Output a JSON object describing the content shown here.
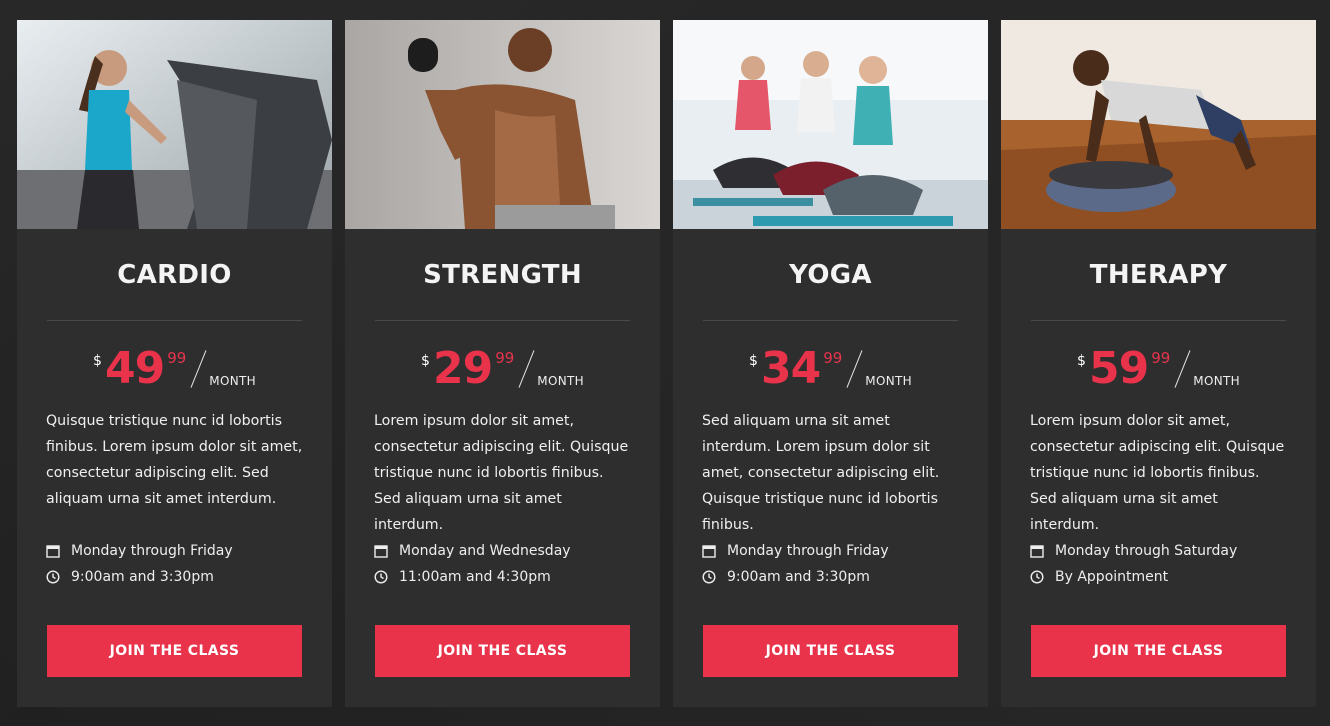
{
  "currency_symbol": "$",
  "per_label": "MONTH",
  "button_label": "JOIN THE CLASS",
  "accent_color": "#e8334b",
  "cards": [
    {
      "title": "CARDIO",
      "price": "49",
      "cents": "99",
      "description": "Quisque tristique nunc id lobortis finibus. Lorem ipsum dolor sit amet, consectetur adipiscing elit. Sed aliquam urna sit amet interdum.",
      "days": "Monday through Friday",
      "time": "9:00am and 3:30pm",
      "photo": "woman-on-treadmill"
    },
    {
      "title": "STRENGTH",
      "price": "29",
      "cents": "99",
      "description": "Lorem ipsum dolor sit amet, consectetur adipiscing elit. Quisque tristique nunc id lobortis finibus. Sed aliquam urna sit amet interdum.",
      "days": "Monday and Wednesday",
      "time": "11:00am and 4:30pm",
      "photo": "man-lifting-dumbbell"
    },
    {
      "title": "YOGA",
      "price": "34",
      "cents": "99",
      "description": "Sed aliquam urna sit amet interdum. Lorem ipsum dolor sit amet, consectetur adipiscing elit. Quisque tristique nunc id lobortis finibus.",
      "days": "Monday through Friday",
      "time": "9:00am and 3:30pm",
      "photo": "women-meditating"
    },
    {
      "title": "THERAPY",
      "price": "59",
      "cents": "99",
      "description": "Lorem ipsum dolor sit amet, consectetur adipiscing elit. Quisque tristique nunc id lobortis finibus. Sed aliquam urna sit amet interdum.",
      "days": "Monday through Saturday",
      "time": "By Appointment",
      "photo": "man-pushup-balance-ball"
    }
  ]
}
